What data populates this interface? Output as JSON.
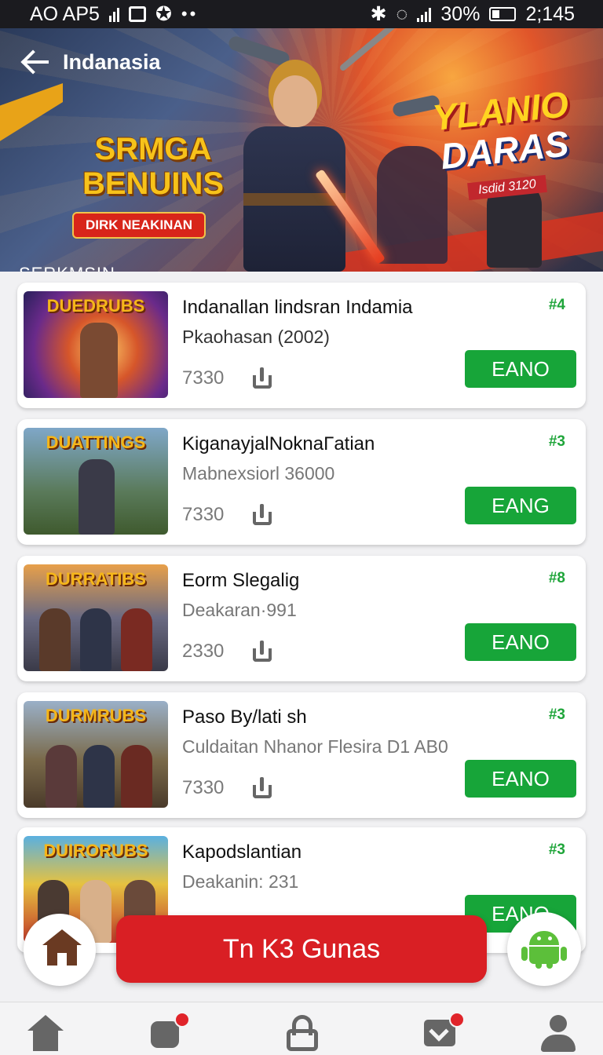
{
  "status_bar": {
    "carrier": "AO AP5",
    "battery_pct": "30%",
    "time": "2;145",
    "dots": "••"
  },
  "banner": {
    "back_label": "Indanasia",
    "title_left": "SRMGA BENUINS",
    "tag_left": "DIRK NEAKINAN",
    "bottom_label": "SERKMSIN",
    "title_right_line1": "YLANIO",
    "title_right_line2": "DARAS",
    "date_right": "Isdid 3120"
  },
  "games": [
    {
      "title": "Indanallan lindsran Indamia",
      "subtitle": "Pkaohasan (2002)",
      "count": "7330",
      "rank": "#4",
      "button": "EANO",
      "thumb_logo": "DUEDRUBS",
      "subtitle_gray": false
    },
    {
      "title": "KiganayjalNoknaΓatian",
      "subtitle": "Mabnexsiorl 36000",
      "count": "7330",
      "rank": "#3",
      "button": "EANG",
      "thumb_logo": "DUATTINGS",
      "subtitle_gray": true
    },
    {
      "title": "Eorm Slegalig",
      "subtitle": "Deakaran·991",
      "count": "2330",
      "rank": "#8",
      "button": "EANO",
      "thumb_logo": "DURRATIBS",
      "subtitle_gray": true
    },
    {
      "title": "Paso By/lati sh",
      "subtitle": "Culdaitan Nhanor Flesira D1 AB0",
      "count": "7330",
      "rank": "#3",
      "button": "EANO",
      "thumb_logo": "DURMRUBS",
      "subtitle_gray": true
    },
    {
      "title": "Kapodslantian",
      "subtitle": "Deakanin: 231",
      "count": "",
      "rank": "#3",
      "button": "EANO",
      "thumb_logo": "DUIRORUBS",
      "subtitle_gray": true
    }
  ],
  "cta": {
    "label": "Tn K3 Gunas"
  },
  "colors": {
    "accent_green": "#17a539",
    "cta_red": "#d91f24",
    "badge_red": "#e0242a"
  },
  "bottom_nav": [
    {
      "icon": "home-icon",
      "badge": false
    },
    {
      "icon": "chat-icon",
      "badge": true
    },
    {
      "icon": "lock-icon",
      "badge": false
    },
    {
      "icon": "inbox-icon",
      "badge": true
    },
    {
      "icon": "user-icon",
      "badge": false
    }
  ]
}
